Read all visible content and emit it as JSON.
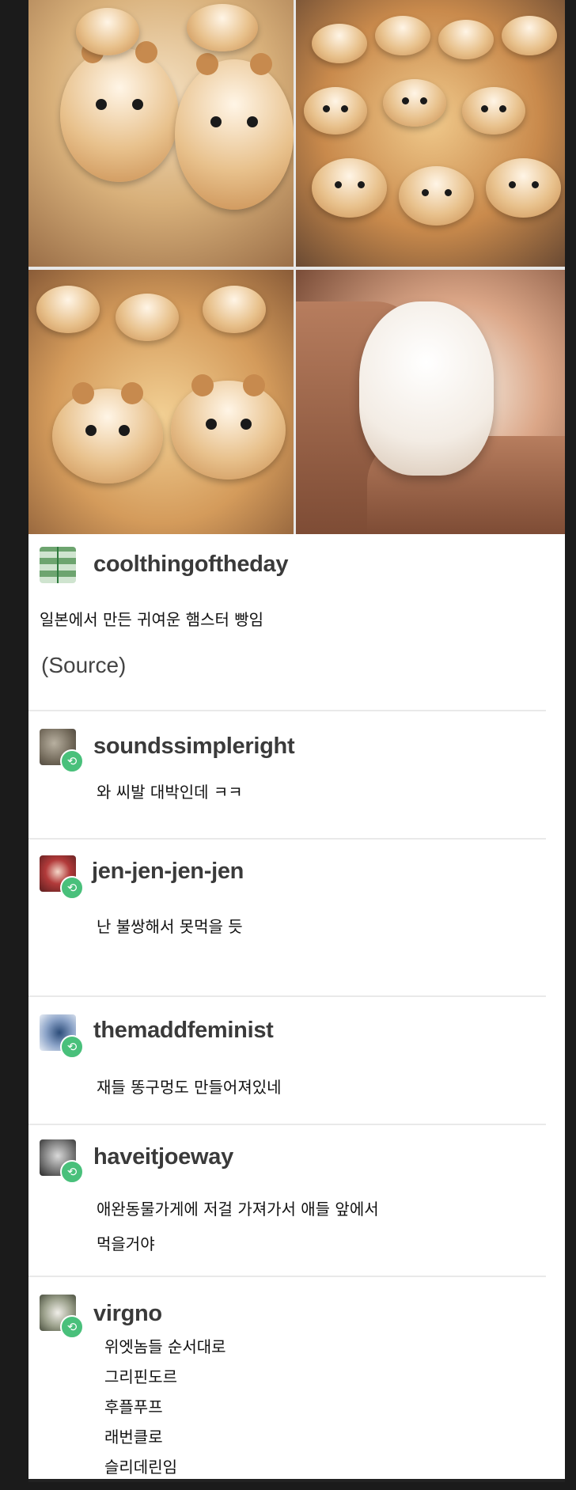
{
  "post": {
    "username": "coolthingoftheday",
    "text": "일본에서 만든 귀여운 햄스터 빵임",
    "source_label": "(Source)"
  },
  "reblogs": [
    {
      "username": "soundssimpleright",
      "lines": [
        "와 씨발 대박인데 ㅋㅋ"
      ]
    },
    {
      "username": "jen-jen-jen-jen",
      "lines": [
        "난 불쌍해서 못먹을 듯"
      ]
    },
    {
      "username": "themaddfeminist",
      "lines": [
        "재들 똥구멍도 만들어져있네"
      ]
    },
    {
      "username": "haveitjoeway",
      "lines": [
        "애완동물가게에 저걸 가져가서 애들 앞에서",
        "먹을거야"
      ]
    },
    {
      "username": "virgno",
      "lines": [
        "위엣놈들 순서대로",
        "그리핀도르",
        "후플푸프",
        "래번클로",
        "슬리데린임"
      ]
    }
  ],
  "icons": {
    "reblog_badge": "reblog-icon"
  },
  "colors": {
    "reblog_badge": "#49c07b",
    "username": "#3a3a3a"
  }
}
